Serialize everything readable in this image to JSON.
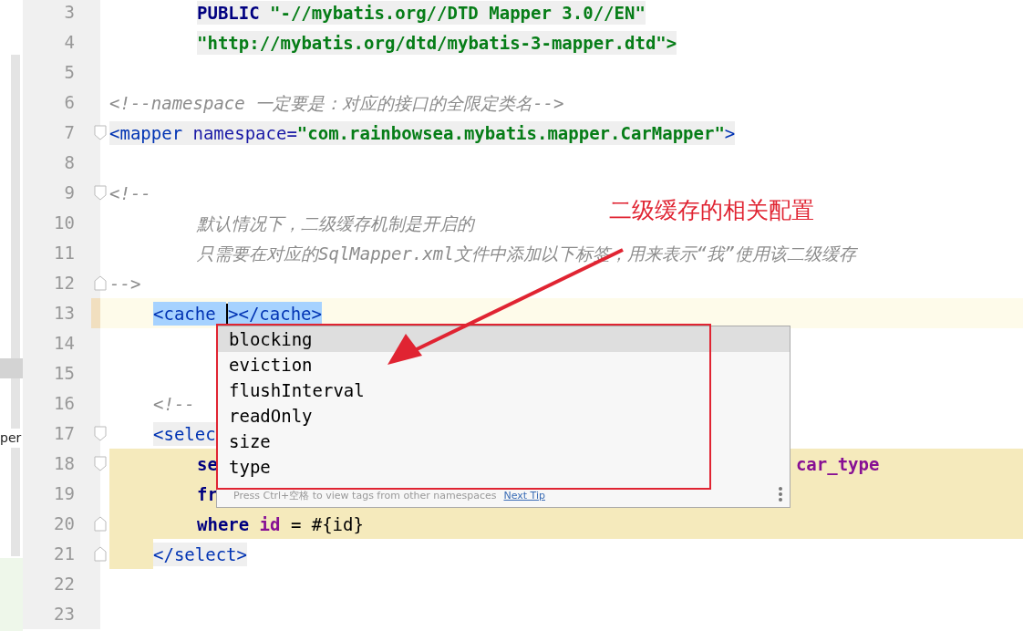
{
  "side_panel": {
    "label": "per"
  },
  "editor": {
    "lines": [
      {
        "number": "3",
        "indented": true,
        "nested": true,
        "tag_background": true,
        "tokens": [
          {
            "kind": "keyword",
            "text": "PUBLIC"
          },
          {
            "kind": "string",
            "text": "\"-//mybatis.org//DTD Mapper 3.0//EN\"",
            "space_before": true
          }
        ]
      },
      {
        "number": "4",
        "indented": true,
        "nested": true,
        "tag_background": true,
        "tokens": [
          {
            "kind": "string",
            "text": "\"http://mybatis.org/dtd/mybatis-3-mapper.dtd\">"
          }
        ]
      },
      {
        "number": "5"
      },
      {
        "number": "6",
        "tokens": [
          {
            "kind": "comment",
            "text": "<!--namespace 一定要是：对应的接口的全限定类名-->"
          }
        ]
      },
      {
        "number": "7",
        "fold_start": true,
        "tag_background": true,
        "tokens": [
          {
            "kind": "tag",
            "text": "<mapper"
          },
          {
            "kind": "attr",
            "text": "namespace=",
            "space_before": true
          },
          {
            "kind": "string",
            "text": "\"com.rainbowsea.mybatis.mapper.CarMapper\""
          },
          {
            "kind": "tag",
            "text": ">"
          }
        ]
      },
      {
        "number": "8"
      },
      {
        "number": "9",
        "fold_start": true,
        "tokens": [
          {
            "kind": "comment",
            "text": "<!--"
          }
        ]
      },
      {
        "number": "10",
        "indented": true,
        "nested": true,
        "tokens": [
          {
            "kind": "comment",
            "text": "默认情况下，二级缓存机制是开启的"
          }
        ]
      },
      {
        "number": "11",
        "indented": true,
        "nested": true,
        "tokens": [
          {
            "kind": "comment",
            "text": "只需要在对应的SqlMapper.xml文件中添加以下标签，用来表示“我”使用该二级缓存"
          }
        ]
      },
      {
        "number": "12",
        "fold_end": true,
        "tokens": [
          {
            "kind": "comment",
            "text": "-->"
          }
        ]
      },
      {
        "number": "13",
        "indented": true,
        "current": true,
        "tokens": [
          {
            "kind": "tag",
            "text": "<cache",
            "selected": true
          },
          {
            "kind": "caret"
          },
          {
            "kind": "tag",
            "text": "></cache>",
            "selected": true
          }
        ]
      },
      {
        "number": "14"
      },
      {
        "number": "15"
      },
      {
        "number": "16",
        "indented": true,
        "tokens": [
          {
            "kind": "comment",
            "text": "<!--"
          }
        ]
      },
      {
        "number": "17",
        "indented": true,
        "fold_start": true,
        "tag_background": true,
        "tokens": [
          {
            "kind": "tag",
            "text": "<selec"
          }
        ]
      },
      {
        "number": "18",
        "indented": true,
        "nested": true,
        "fold_start": true,
        "in_block": true,
        "tokens": [
          {
            "kind": "keyword",
            "text": "se"
          },
          {
            "kind": "field",
            "text": "car_type",
            "far_right": true
          }
        ]
      },
      {
        "number": "19",
        "indented": true,
        "nested": true,
        "in_block": true,
        "tokens": [
          {
            "kind": "keyword",
            "text": "fr"
          }
        ]
      },
      {
        "number": "20",
        "indented": true,
        "nested": true,
        "fold_end": true,
        "in_block": true,
        "tokens": [
          {
            "kind": "keyword",
            "text": "where"
          },
          {
            "kind": "field",
            "text": "id",
            "space_before": true
          },
          {
            "kind": "plain",
            "text": "=",
            "space_before": true
          },
          {
            "kind": "expr",
            "text": "#{id}",
            "space_before": true
          }
        ]
      },
      {
        "number": "21",
        "indented": true,
        "fold_end": true,
        "in_block": true,
        "block_end": true,
        "tag_background": true,
        "tokens": [
          {
            "kind": "tag",
            "text": "</select>"
          }
        ]
      },
      {
        "number": "22"
      },
      {
        "number": "23"
      }
    ]
  },
  "completion_popup": {
    "items": [
      {
        "label": "blocking",
        "selected": true
      },
      {
        "label": "eviction",
        "selected": false
      },
      {
        "label": "flushInterval",
        "selected": false
      },
      {
        "label": "readOnly",
        "selected": false
      },
      {
        "label": "size",
        "selected": false
      },
      {
        "label": "type",
        "selected": false
      }
    ],
    "hint": "Press Ctrl+空格 to view tags from other namespaces",
    "next_tip": "Next Tip"
  },
  "annotation": {
    "text": "二级缓存的相关配置"
  }
}
